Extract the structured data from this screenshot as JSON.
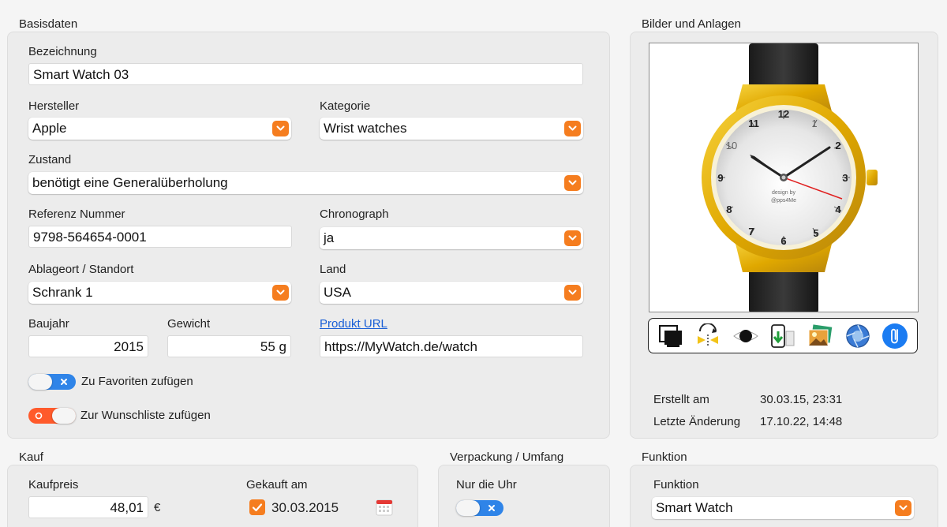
{
  "sections": {
    "basisdaten": "Basisdaten",
    "bilder": "Bilder und Anlagen",
    "kauf": "Kauf",
    "verpackung": "Verpackung / Umfang",
    "funktion": "Funktion"
  },
  "basis": {
    "bezeichnung": {
      "label": "Bezeichnung",
      "value": "Smart Watch 03"
    },
    "hersteller": {
      "label": "Hersteller",
      "value": "Apple"
    },
    "kategorie": {
      "label": "Kategorie",
      "value": "Wrist watches"
    },
    "zustand": {
      "label": "Zustand",
      "value": "benötigt eine Generalüberholung"
    },
    "referenz": {
      "label": "Referenz Nummer",
      "value": "9798-564654-0001"
    },
    "chronograph": {
      "label": "Chronograph",
      "value": "ja"
    },
    "ablageort": {
      "label": "Ablageort / Standort",
      "value": "Schrank 1"
    },
    "land": {
      "label": "Land",
      "value": "USA"
    },
    "baujahr": {
      "label": "Baujahr",
      "value": "2015"
    },
    "gewicht": {
      "label": "Gewicht",
      "value": "55 g"
    },
    "produkt_url": {
      "label": "Produkt URL",
      "value": "https://MyWatch.de/watch"
    },
    "favoriten": {
      "label": "Zu Favoriten zufügen",
      "on": true
    },
    "wunschliste": {
      "label": "Zur Wunschliste zufügen",
      "on": false
    }
  },
  "image": {
    "dial_numbers": [
      "12",
      "1",
      "2",
      "3",
      "4",
      "5",
      "6",
      "7",
      "8",
      "9",
      "10",
      "11"
    ],
    "credit_line1": "design by",
    "credit_line2": "@pps4Me"
  },
  "toolbar_icons": [
    "display-icon",
    "rotate-flip-icon",
    "eye-icon",
    "phone-import-icon",
    "photos-icon",
    "aperture-icon",
    "paperclip-icon"
  ],
  "meta": {
    "erstellt_label": "Erstellt am",
    "erstellt_value": "30.03.15, 23:31",
    "aenderung_label": "Letzte Änderung",
    "aenderung_value": "17.10.22, 14:48"
  },
  "kauf": {
    "kaufpreis_label": "Kaufpreis",
    "kaufpreis_value": "48,01",
    "currency": "€",
    "gekauft_label": "Gekauft am",
    "gekauft_value": "30.03.2015",
    "gekauft_checked": true
  },
  "verpackung": {
    "nur_uhr_label": "Nur die Uhr",
    "nur_uhr_on": true
  },
  "funktion": {
    "label": "Funktion",
    "value": "Smart Watch"
  },
  "colors": {
    "accent": "#f57d1f",
    "toggle_blue": "#2f84e8",
    "toggle_red": "#ff5a2b",
    "link": "#1a5fd6"
  }
}
